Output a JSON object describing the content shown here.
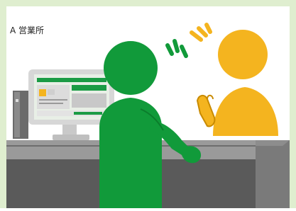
{
  "scene": {
    "office_label": "A 営業所",
    "colors": {
      "border": "#dfeecf",
      "background": "#ffffff",
      "staff_green": "#119a3a",
      "staff_green_dark": "#0b7d2c",
      "customer_yellow": "#f4b41f",
      "customer_outline": "#c88a00",
      "counter_dark": "#5a5a5a",
      "counter_light": "#7a7a7a",
      "counter_top": "#9a9a9a",
      "monitor_bezel": "#d7d7d7",
      "monitor_screen": "#e8efe6"
    },
    "icons": {
      "staff": "person-icon",
      "customer": "person-icon",
      "staff_speech": "speech-burst-icon",
      "customer_speech": "speech-burst-icon",
      "monitor": "monitor-icon",
      "pc_tower": "pc-tower-icon"
    }
  }
}
